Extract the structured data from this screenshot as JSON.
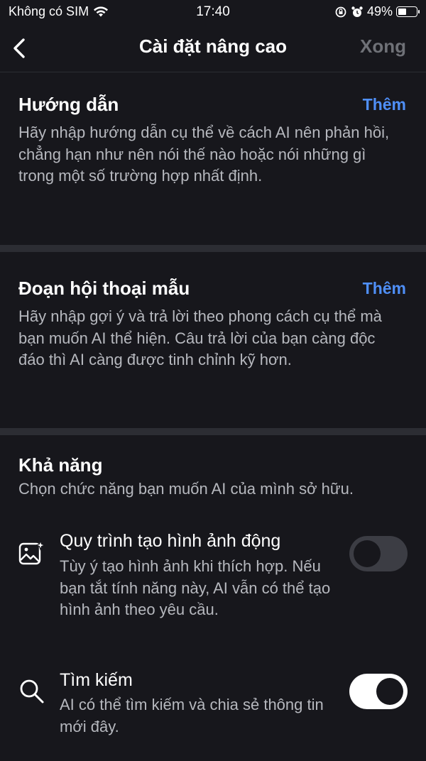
{
  "status_bar": {
    "carrier": "Không có SIM",
    "time": "17:40",
    "battery_percent": "49%",
    "battery_level": 0.49
  },
  "nav": {
    "title": "Cài đặt nâng cao",
    "done_label": "Xong"
  },
  "instructions": {
    "title": "Hướng dẫn",
    "add_label": "Thêm",
    "description": "Hãy nhập hướng dẫn cụ thể về cách AI nên phản hồi, chẳng hạn như nên nói thế nào hoặc nói những gì trong một số trường hợp nhất định."
  },
  "sample_dialogue": {
    "title": "Đoạn hội thoại mẫu",
    "add_label": "Thêm",
    "description": "Hãy nhập gợi ý và trả lời theo phong cách cụ thể mà bạn muốn AI thể hiện. Câu trả lời của bạn càng độc đáo thì AI càng được tinh chỉnh kỹ hơn."
  },
  "capabilities": {
    "title": "Khả năng",
    "subtitle": "Chọn chức năng bạn muốn AI của mình sở hữu.",
    "features": [
      {
        "icon": "image-sparkle-icon",
        "title": "Quy trình tạo hình ảnh động",
        "description": "Tùy ý tạo hình ảnh khi thích hợp. Nếu bạn tắt tính năng này, AI vẫn có thể tạo hình ảnh theo yêu cầu.",
        "enabled": false
      },
      {
        "icon": "search-icon",
        "title": "Tìm kiếm",
        "description": "AI có thể tìm kiếm và chia sẻ thông tin mới đây.",
        "enabled": true
      }
    ]
  },
  "colors": {
    "background": "#17171c",
    "accent": "#4f8ff7",
    "divider": "#2c2d33"
  }
}
